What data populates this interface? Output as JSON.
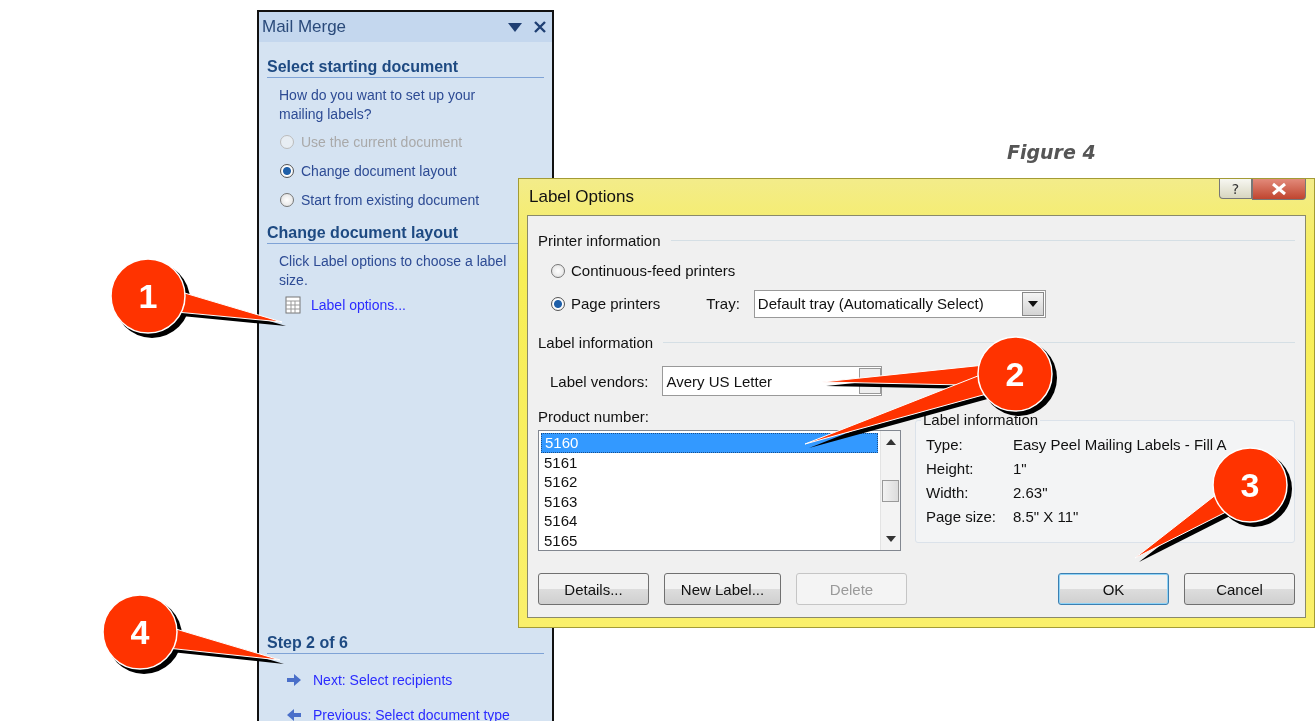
{
  "figure_caption": "Figure 4",
  "task_pane": {
    "title": "Mail Merge",
    "start_heading": "Select starting document",
    "prompt": "How do you want to set up your mailing labels?",
    "options": [
      {
        "label": "Use the current document",
        "selected": false,
        "disabled": true
      },
      {
        "label": "Change document layout",
        "selected": true,
        "disabled": false
      },
      {
        "label": "Start from existing document",
        "selected": false,
        "disabled": false
      }
    ],
    "layout_heading": "Change document layout",
    "instruction": "Click Label options to choose a label size.",
    "link": "Label options...",
    "step": "Step 2 of 6",
    "nav": [
      {
        "label": "Next: Select recipients",
        "kind": "next"
      },
      {
        "label": "Previous: Select document type",
        "kind": "previous"
      }
    ]
  },
  "dialog": {
    "title": "Label Options",
    "help_button": "?",
    "printer_group": {
      "title": "Printer information",
      "options": [
        {
          "label": "Continuous-feed printers",
          "selected": false
        },
        {
          "label": "Page printers",
          "selected": true
        }
      ],
      "tray_label": "Tray:",
      "tray_value": "Default tray (Automatically Select)"
    },
    "label_group": {
      "title": "Label information",
      "vendors_label": "Label vendors:",
      "vendors_value": "Avery US Letter",
      "product_label": "Product number:",
      "products": [
        {
          "label": "5160",
          "selected": true
        },
        {
          "label": "5161",
          "selected": false
        },
        {
          "label": "5162",
          "selected": false
        },
        {
          "label": "5163",
          "selected": false
        },
        {
          "label": "5164",
          "selected": false
        },
        {
          "label": "5165",
          "selected": false
        }
      ],
      "info_title": "Label information",
      "info": [
        {
          "name": "Type:",
          "value": "Easy Peel Mailing Labels - Fill A"
        },
        {
          "name": "Height:",
          "value": "1\""
        },
        {
          "name": "Width:",
          "value": "2.63\""
        },
        {
          "name": "Page size:",
          "value": "8.5\" X 11\""
        }
      ]
    },
    "buttons": [
      {
        "label": "Details...",
        "disabled": false,
        "default": false
      },
      {
        "label": "New Label...",
        "disabled": false,
        "default": false
      },
      {
        "label": "Delete",
        "disabled": true,
        "default": false
      },
      {
        "label": "OK",
        "disabled": false,
        "default": true
      },
      {
        "label": "Cancel",
        "disabled": false,
        "default": false
      }
    ]
  },
  "callouts": [
    "1",
    "2",
    "3",
    "4"
  ]
}
